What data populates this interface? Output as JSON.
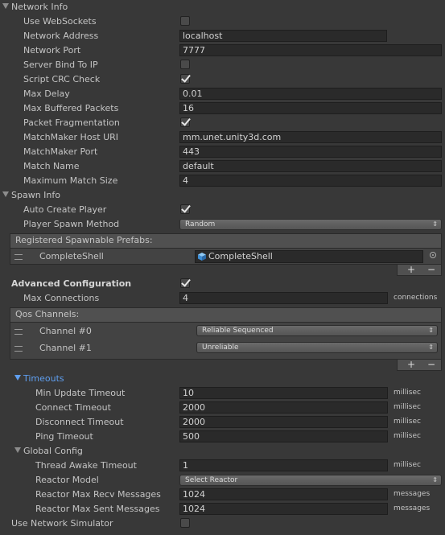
{
  "network_info": {
    "title": "Network Info",
    "fields": {
      "use_websockets": {
        "label": "Use WebSockets",
        "checked": false
      },
      "network_address": {
        "label": "Network Address",
        "value": "localhost"
      },
      "network_port": {
        "label": "Network Port",
        "value": "7777"
      },
      "server_bind_to_ip": {
        "label": "Server Bind To IP",
        "checked": false
      },
      "script_crc_check": {
        "label": "Script CRC Check",
        "checked": true
      },
      "max_delay": {
        "label": "Max Delay",
        "value": "0.01"
      },
      "max_buffered_packets": {
        "label": "Max Buffered Packets",
        "value": "16"
      },
      "packet_fragmentation": {
        "label": "Packet Fragmentation",
        "checked": true
      },
      "matchmaker_host_uri": {
        "label": "MatchMaker Host URI",
        "value": "mm.unet.unity3d.com"
      },
      "matchmaker_port": {
        "label": "MatchMaker Port",
        "value": "443"
      },
      "match_name": {
        "label": "Match Name",
        "value": "default"
      },
      "maximum_match_size": {
        "label": "Maximum Match Size",
        "value": "4"
      }
    }
  },
  "spawn_info": {
    "title": "Spawn Info",
    "auto_create_player": {
      "label": "Auto Create Player",
      "checked": true
    },
    "player_spawn_method": {
      "label": "Player Spawn Method",
      "value": "Random"
    },
    "prefabs_header": "Registered Spawnable Prefabs:",
    "prefabs": [
      {
        "name": "CompleteShell",
        "object": "CompleteShell"
      }
    ]
  },
  "advanced": {
    "title": "Advanced Configuration",
    "checked": true,
    "max_connections": {
      "label": "Max Connections",
      "value": "4",
      "unit": "connections"
    },
    "qos_header": "Qos Channels:",
    "channels": [
      {
        "name": "Channel #0",
        "type": "Reliable Sequenced"
      },
      {
        "name": "Channel #1",
        "type": "Unreliable"
      }
    ]
  },
  "timeouts": {
    "title": "Timeouts",
    "min_update": {
      "label": "Min Update Timeout",
      "value": "10",
      "unit": "millisec"
    },
    "connect": {
      "label": "Connect Timeout",
      "value": "2000",
      "unit": "millisec"
    },
    "disconnect": {
      "label": "Disconnect Timeout",
      "value": "2000",
      "unit": "millisec"
    },
    "ping": {
      "label": "Ping Timeout",
      "value": "500",
      "unit": "millisec"
    }
  },
  "global_config": {
    "title": "Global Config",
    "thread_awake": {
      "label": "Thread Awake Timeout",
      "value": "1",
      "unit": "millisec"
    },
    "reactor_model": {
      "label": "Reactor Model",
      "value": "Select Reactor"
    },
    "max_recv": {
      "label": "Reactor Max Recv Messages",
      "value": "1024",
      "unit": "messages"
    },
    "max_sent": {
      "label": "Reactor Max Sent Messages",
      "value": "1024",
      "unit": "messages"
    }
  },
  "simulator": {
    "label": "Use Network Simulator",
    "checked": false
  },
  "symbols": {
    "plus": "+",
    "minus": "−",
    "updown": "⇕"
  },
  "colors": {
    "background": "#383838",
    "field": "#2a2a2a",
    "accent_blue": "#5f9ff0"
  }
}
